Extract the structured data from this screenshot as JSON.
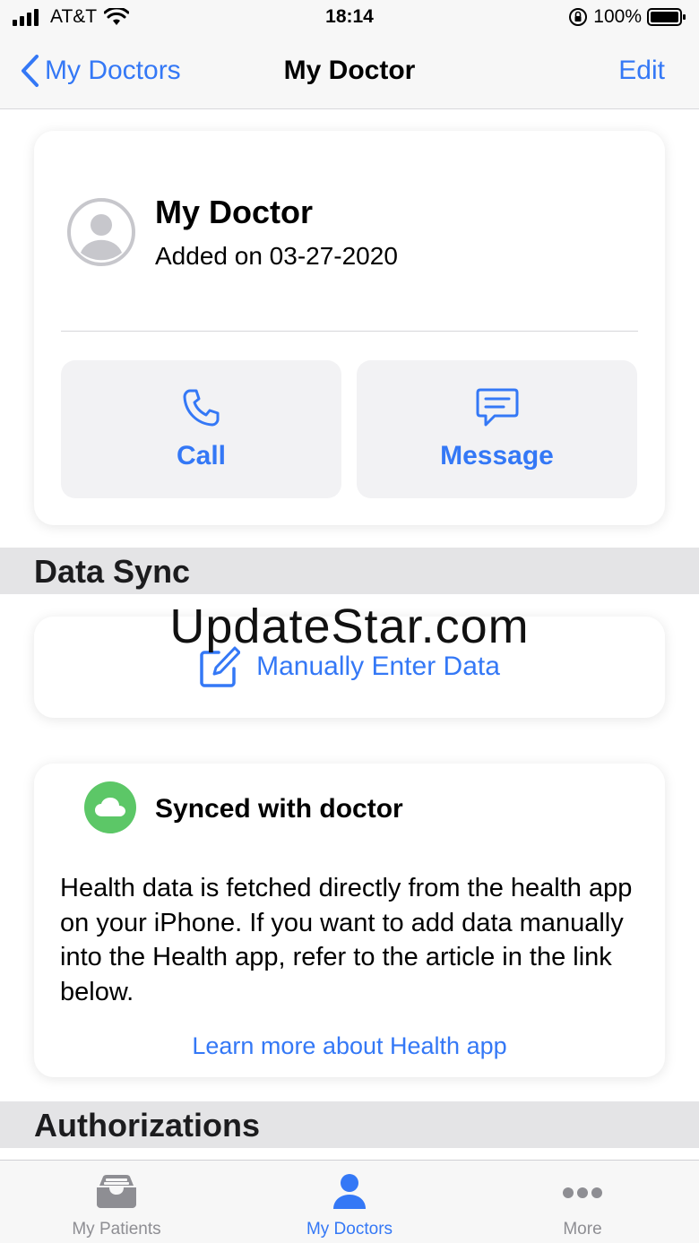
{
  "status_bar": {
    "carrier": "AT&T",
    "time": "18:14",
    "battery": "100%"
  },
  "nav": {
    "back_label": "My Doctors",
    "title": "My Doctor",
    "edit_label": "Edit"
  },
  "doctor": {
    "name": "My Doctor",
    "added": "Added on 03-27-2020",
    "call_label": "Call",
    "message_label": "Message"
  },
  "sections": {
    "data_sync": "Data Sync",
    "authorizations": "Authorizations"
  },
  "manual_entry": {
    "label": "Manually Enter Data"
  },
  "watermark": "UpdateStar.com",
  "sync": {
    "title": "Synced with doctor",
    "body": "Health data is fetched directly from the health app on your iPhone. If you want to add data manually into the Health app, refer to the article in the link below.",
    "link": "Learn more about Health app"
  },
  "tabs": [
    {
      "label": "My Patients",
      "icon": "inbox-tray-icon",
      "active": false
    },
    {
      "label": "My Doctors",
      "icon": "person-icon",
      "active": true
    },
    {
      "label": "More",
      "icon": "ellipsis-icon",
      "active": false
    }
  ],
  "colors": {
    "accent": "#3478f6",
    "sync_green": "#5cc767",
    "section_bg": "#e4e4e6"
  }
}
